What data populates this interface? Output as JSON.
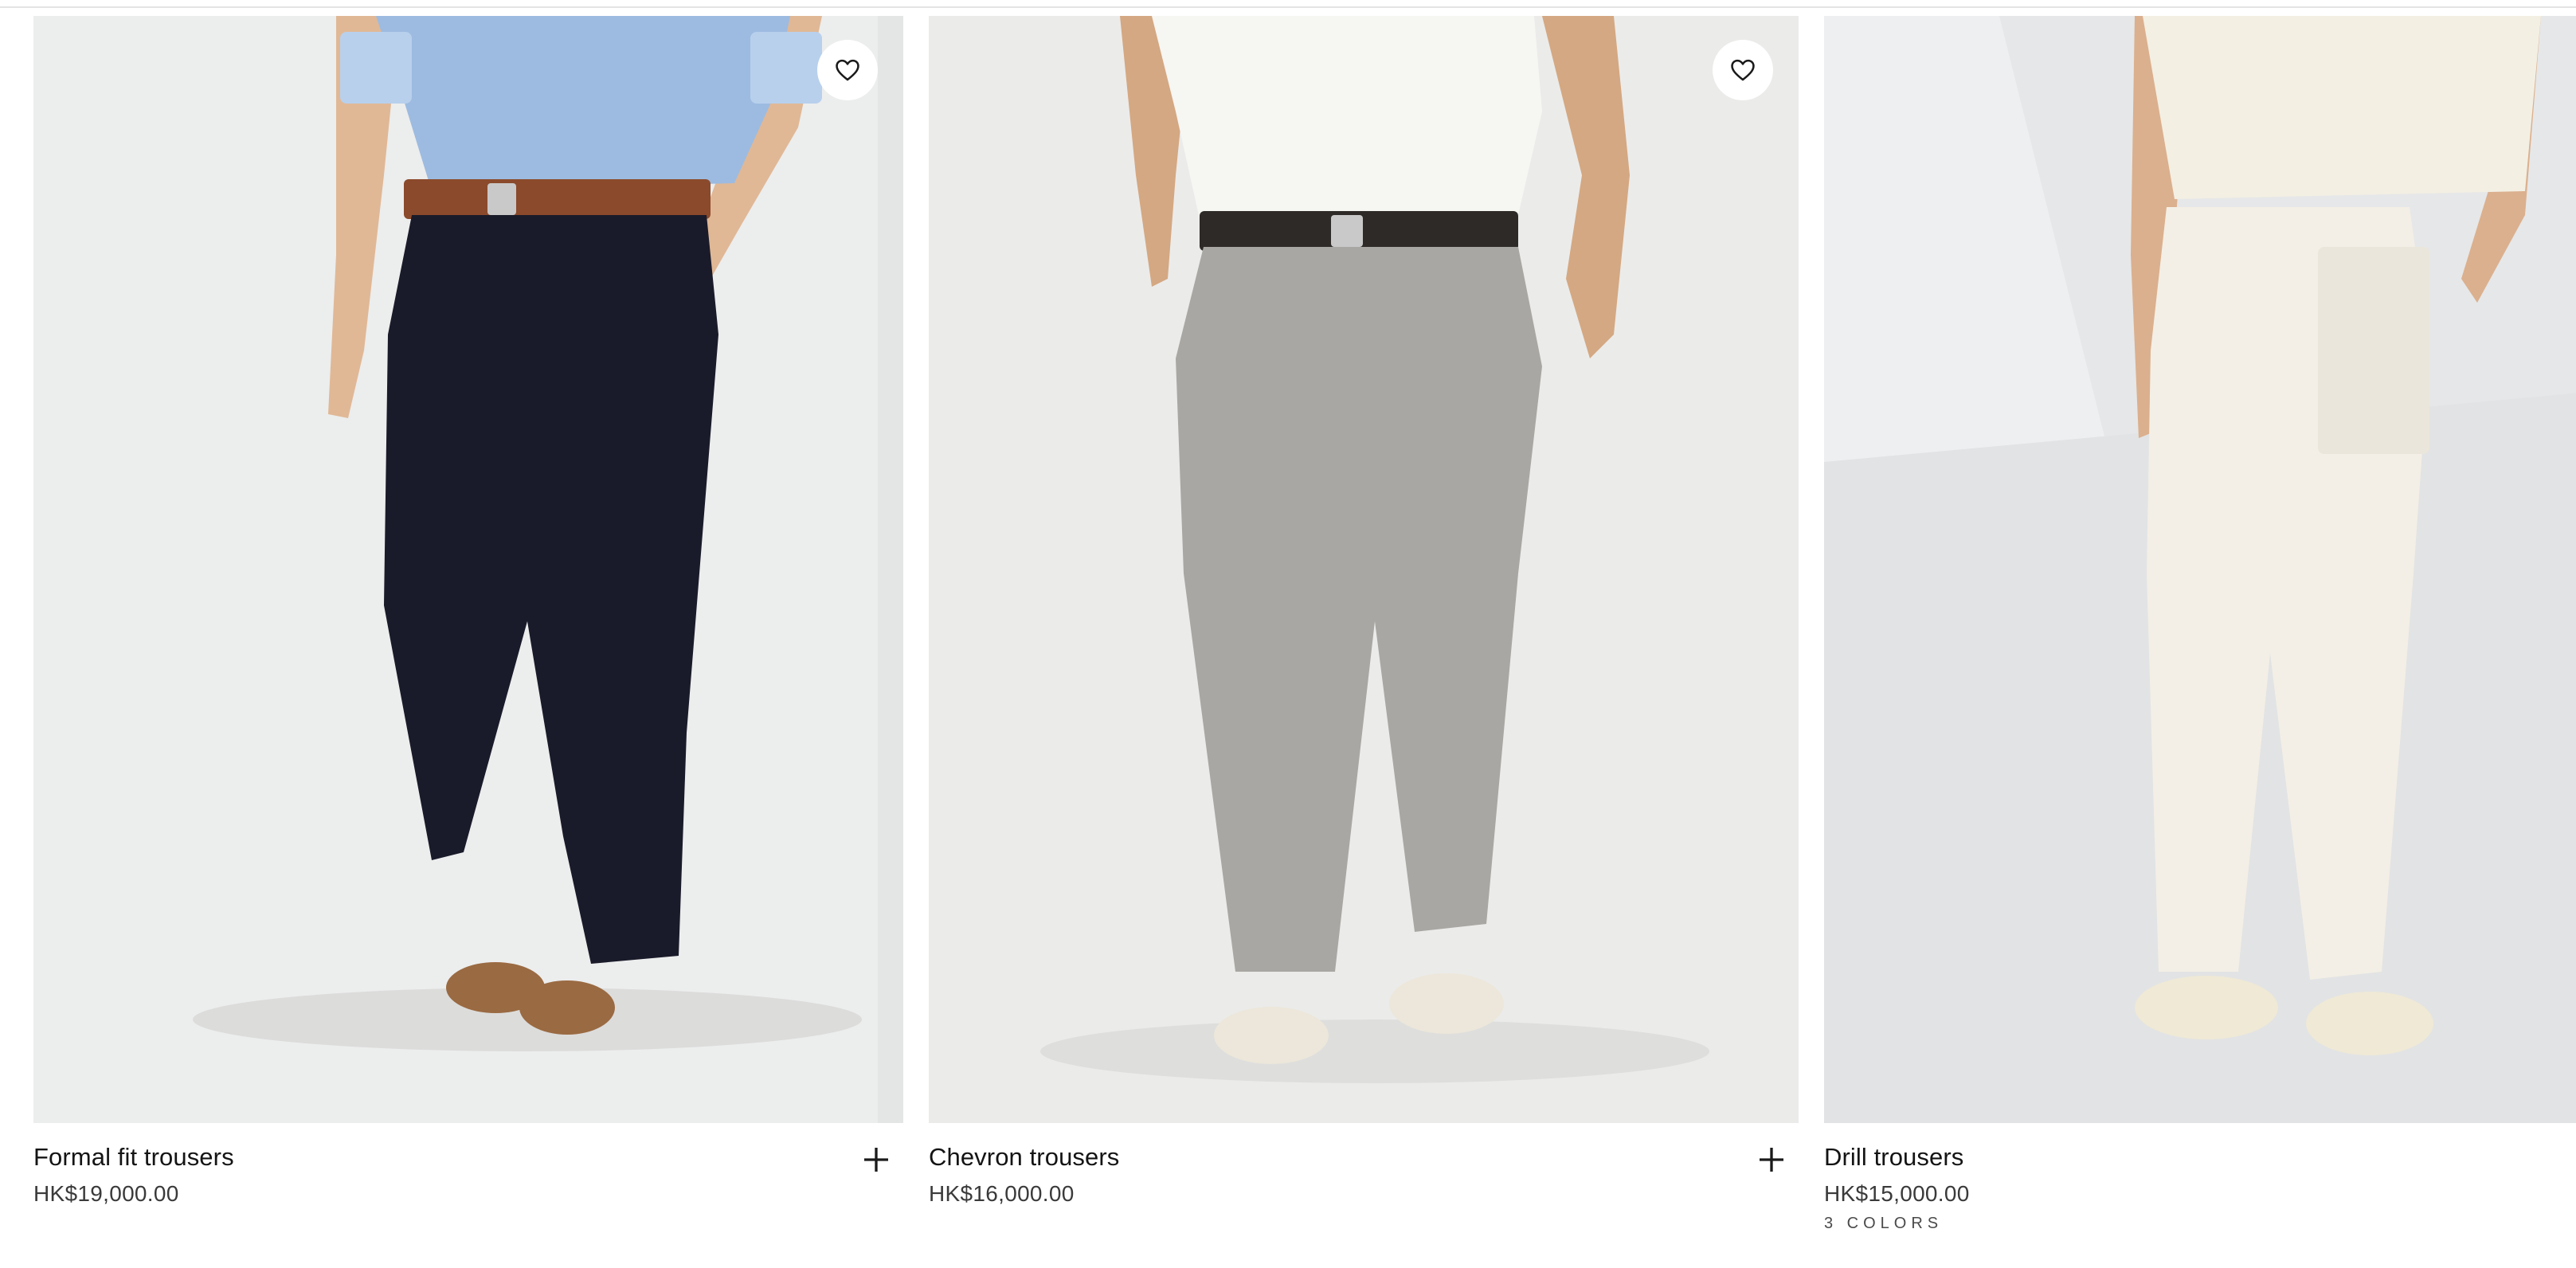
{
  "products": [
    {
      "name": "Formal fit trousers",
      "price": "HK$19,000.00",
      "image_alt": "Formal fit trousers",
      "wishlist_icon": "heart-icon",
      "add_icon": "plus-icon"
    },
    {
      "name": "Chevron trousers",
      "price": "HK$16,000.00",
      "image_alt": "Chevron trousers",
      "wishlist_icon": "heart-icon",
      "add_icon": "plus-icon"
    },
    {
      "name": "Drill trousers",
      "price": "HK$15,000.00",
      "colors": "3 COLORS",
      "image_alt": "Drill trousers"
    }
  ],
  "palette": {
    "background": "#ffffff",
    "image_bg": "#ececea",
    "text": "#141414",
    "price_text": "#3a3a3a"
  }
}
